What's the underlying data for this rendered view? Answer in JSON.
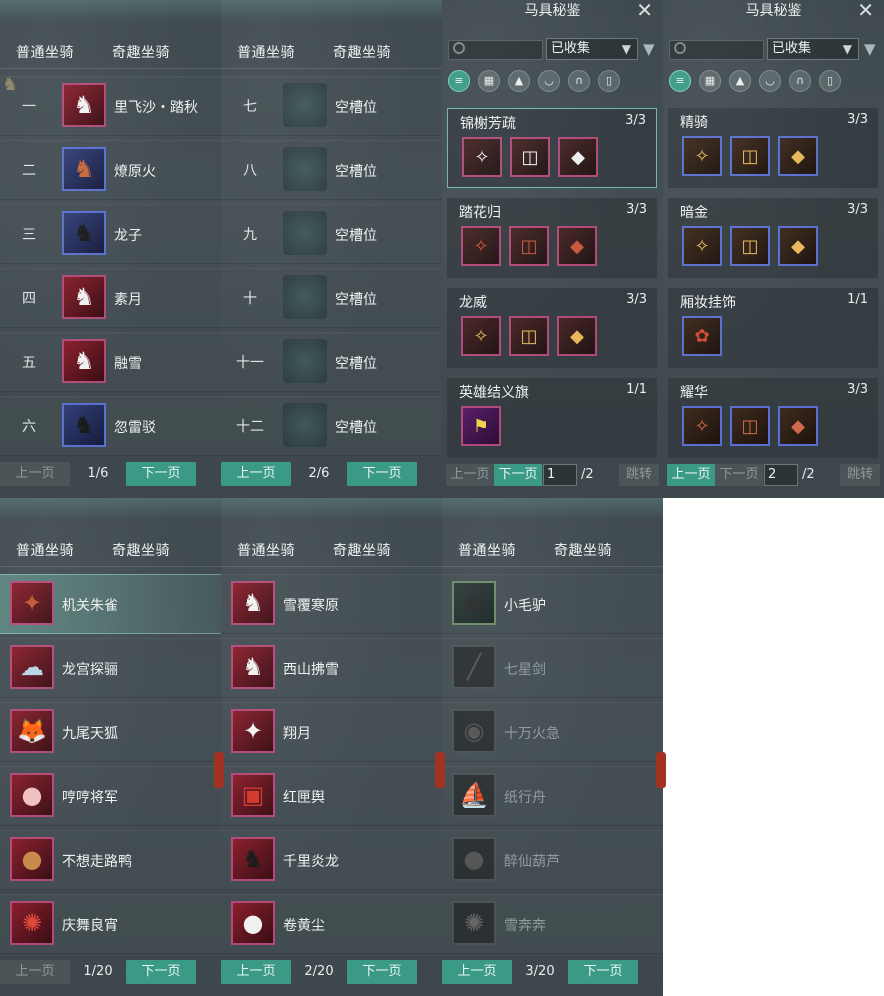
{
  "tabs": {
    "normal": "普通坐骑",
    "fun": "奇趣坐骑"
  },
  "pager": {
    "prev": "上一页",
    "next": "下一页"
  },
  "panel_a": {
    "page": "1/6",
    "slots": [
      {
        "num": "一",
        "name": "里飞沙・踏秋",
        "icon": "white-horse-icon"
      },
      {
        "num": "二",
        "name": "燎原火",
        "icon": "brown-horse-icon"
      },
      {
        "num": "三",
        "name": "龙子",
        "icon": "black-horse-icon"
      },
      {
        "num": "四",
        "name": "素月",
        "icon": "white-horse-icon"
      },
      {
        "num": "五",
        "name": "融雪",
        "icon": "white-horse-icon"
      },
      {
        "num": "六",
        "name": "忽雷驳",
        "icon": "black-horse-icon"
      }
    ]
  },
  "panel_b": {
    "page": "2/6",
    "slots": [
      {
        "num": "七",
        "name": "空槽位"
      },
      {
        "num": "八",
        "name": "空槽位"
      },
      {
        "num": "九",
        "name": "空槽位"
      },
      {
        "num": "十",
        "name": "空槽位"
      },
      {
        "num": "十一",
        "name": "空槽位"
      },
      {
        "num": "十二",
        "name": "空槽位"
      }
    ]
  },
  "codex_1": {
    "title": "马具秘鉴",
    "filter": "已收集",
    "page_value": "1",
    "page_total": "/2",
    "jump": "跳转",
    "groups": [
      {
        "name": "锦榭芳疏",
        "count": "3/3"
      },
      {
        "name": "踏花归",
        "count": "3/3"
      },
      {
        "name": "龙威",
        "count": "3/3"
      },
      {
        "name": "英雄结义旗",
        "count": "1/1"
      }
    ]
  },
  "codex_2": {
    "title": "马具秘鉴",
    "filter": "已收集",
    "page_value": "2",
    "page_total": "/2",
    "jump": "跳转",
    "groups": [
      {
        "name": "精骑",
        "count": "3/3"
      },
      {
        "name": "暗金",
        "count": "3/3"
      },
      {
        "name": "厢妆挂饰",
        "count": "1/1"
      },
      {
        "name": "耀华",
        "count": "3/3"
      }
    ]
  },
  "panel_c": {
    "page": "1/20",
    "items": [
      "机关朱雀",
      "龙宫探骊",
      "九尾天狐",
      "哼哼将军",
      "不想走路鸭",
      "庆舞良宵"
    ]
  },
  "panel_d": {
    "page": "2/20",
    "items": [
      "雪覆寒原",
      "西山拂雪",
      "翔月",
      "红匣舆",
      "千里炎龙",
      "卷黄尘"
    ]
  },
  "panel_e": {
    "page": "3/20",
    "items": [
      "小毛驴",
      "七星剑",
      "十万火急",
      "纸行舟",
      "醉仙葫芦",
      "雪奔奔"
    ]
  },
  "colors": {
    "accent": "#3b9a86",
    "rare_border": "#b04a7a",
    "epic_border": "#5a6fd0"
  }
}
